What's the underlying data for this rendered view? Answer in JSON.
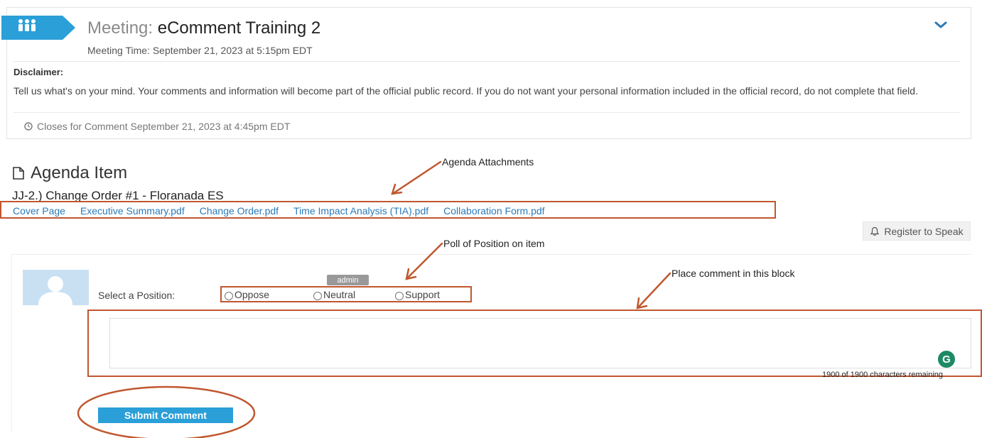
{
  "meeting": {
    "title_prefix": "Meeting:",
    "title": "eComment Training 2",
    "time": "Meeting Time: September 21, 2023 at 5:15pm EDT",
    "disclaimer_label": "Disclaimer:",
    "disclaimer_text": "Tell us what's on your mind. Your comments and information will become part of the official public record. If you do not want your personal information included in the official record, do not complete that field.",
    "closes": "Closes for Comment September 21, 2023 at 4:45pm EDT"
  },
  "agenda": {
    "heading": "Agenda Item",
    "item_title": "JJ-2.) Change Order #1 - Floranada ES",
    "attachments": [
      "Cover Page",
      "Executive Summary.pdf",
      "Change Order.pdf",
      "Time Impact Analysis (TIA).pdf",
      "Collaboration Form.pdf"
    ],
    "register_label": "Register to Speak"
  },
  "comment": {
    "badge": "admin",
    "position_label": "Select a Position:",
    "positions": [
      "Oppose",
      "Neutral",
      "Support"
    ],
    "input_value": "",
    "grammarly_glyph": "G",
    "chars_remaining": "1900 of 1900 characters remaining",
    "submit_label": "Submit Comment"
  },
  "annotations": {
    "attachments": "Agenda Attachments",
    "poll": "Poll of Position on item",
    "comment_block": "Place comment in this block"
  },
  "icons": {
    "meeting": "people-group-icon",
    "expand": "chevron-down-icon",
    "clock": "clock-icon",
    "document": "document-icon",
    "bell": "bell-icon",
    "avatar": "user-silhouette-icon",
    "grammarly": "grammarly-icon"
  },
  "colors": {
    "accent": "#2a9fd8",
    "link": "#2a7ab8",
    "annotation": "#c0572f"
  }
}
